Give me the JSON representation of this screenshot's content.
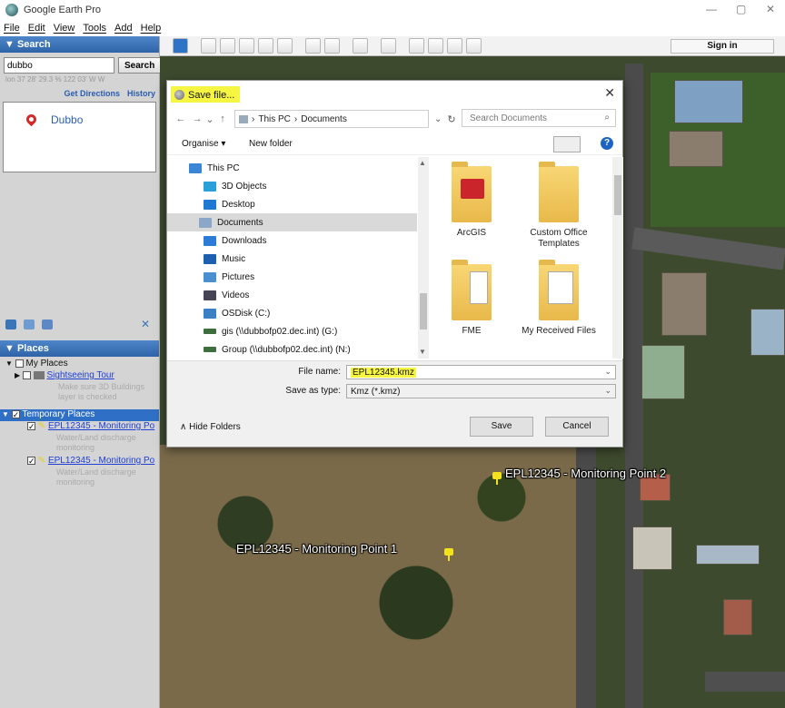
{
  "window": {
    "title": "Google Earth Pro",
    "controls": [
      "—",
      "▢",
      "✕"
    ]
  },
  "menu": [
    "File",
    "Edit",
    "View",
    "Tools",
    "Add",
    "Help"
  ],
  "search_panel": {
    "header": "▼ Search",
    "query": "dubbo",
    "button": "Search",
    "coords": "lon 37 28' 29.3 % 122 03' W W",
    "get_directions": "Get Directions",
    "history": "History",
    "result": "Dubbo"
  },
  "places_panel": {
    "header": "▼ Places",
    "my_places": "My Places",
    "sightseeing": "Sightseeing Tour",
    "sightseeing_note": [
      "Make sure 3D Buildings",
      "layer is checked"
    ],
    "temporary": "Temporary Places",
    "items": [
      {
        "label": "EPL12345 - Monitoring Po",
        "note": [
          "Water/Land discharge",
          "monitoring"
        ]
      },
      {
        "label": "EPL12345 - Monitoring Po",
        "note": [
          "Water/Land discharge",
          "monitoring"
        ]
      }
    ]
  },
  "toolbar": {
    "sign_in": "Sign in"
  },
  "dialog": {
    "title": "Save file...",
    "path": [
      "This PC",
      "Documents"
    ],
    "search_placeholder": "Search Documents",
    "organise": "Organise ▾",
    "new_folder": "New folder",
    "nav_items": [
      {
        "label": "This PC",
        "icon": "computer-icon",
        "color": "#3a86d4"
      },
      {
        "label": "3D Objects",
        "icon": "cube-icon",
        "color": "#2aa0d8"
      },
      {
        "label": "Desktop",
        "icon": "desktop-icon",
        "color": "#1f78d1"
      },
      {
        "label": "Documents",
        "icon": "documents-icon",
        "color": "#8aa6c8"
      },
      {
        "label": "Downloads",
        "icon": "download-icon",
        "color": "#2c7bd6"
      },
      {
        "label": "Music",
        "icon": "music-icon",
        "color": "#1e60b0"
      },
      {
        "label": "Pictures",
        "icon": "pictures-icon",
        "color": "#4a8fd0"
      },
      {
        "label": "Videos",
        "icon": "videos-icon",
        "color": "#445"
      },
      {
        "label": "OSDisk (C:)",
        "icon": "disk-icon",
        "color": "#3b7fc4"
      },
      {
        "label": "gis (\\\\dubbofp02.dec.int) (G:)",
        "icon": "network-drive-icon",
        "color": "#3e6e3e"
      },
      {
        "label": "Group (\\\\dubbofp02.dec.int) (N:)",
        "icon": "network-drive-icon",
        "color": "#3e6e3e"
      }
    ],
    "files": [
      "ArcGIS",
      "Custom Office Templates",
      "FME",
      "My Received Files"
    ],
    "file_name_label": "File name:",
    "file_name": "EPL12345.kmz",
    "save_type_label": "Save as type:",
    "save_type": "Kmz (*.kmz)",
    "hide_folders": "Hide Folders",
    "save": "Save",
    "cancel": "Cancel"
  },
  "map_labels": [
    "EPL12345 - Monitoring Point 2",
    "EPL12345 - Monitoring Point 1"
  ]
}
